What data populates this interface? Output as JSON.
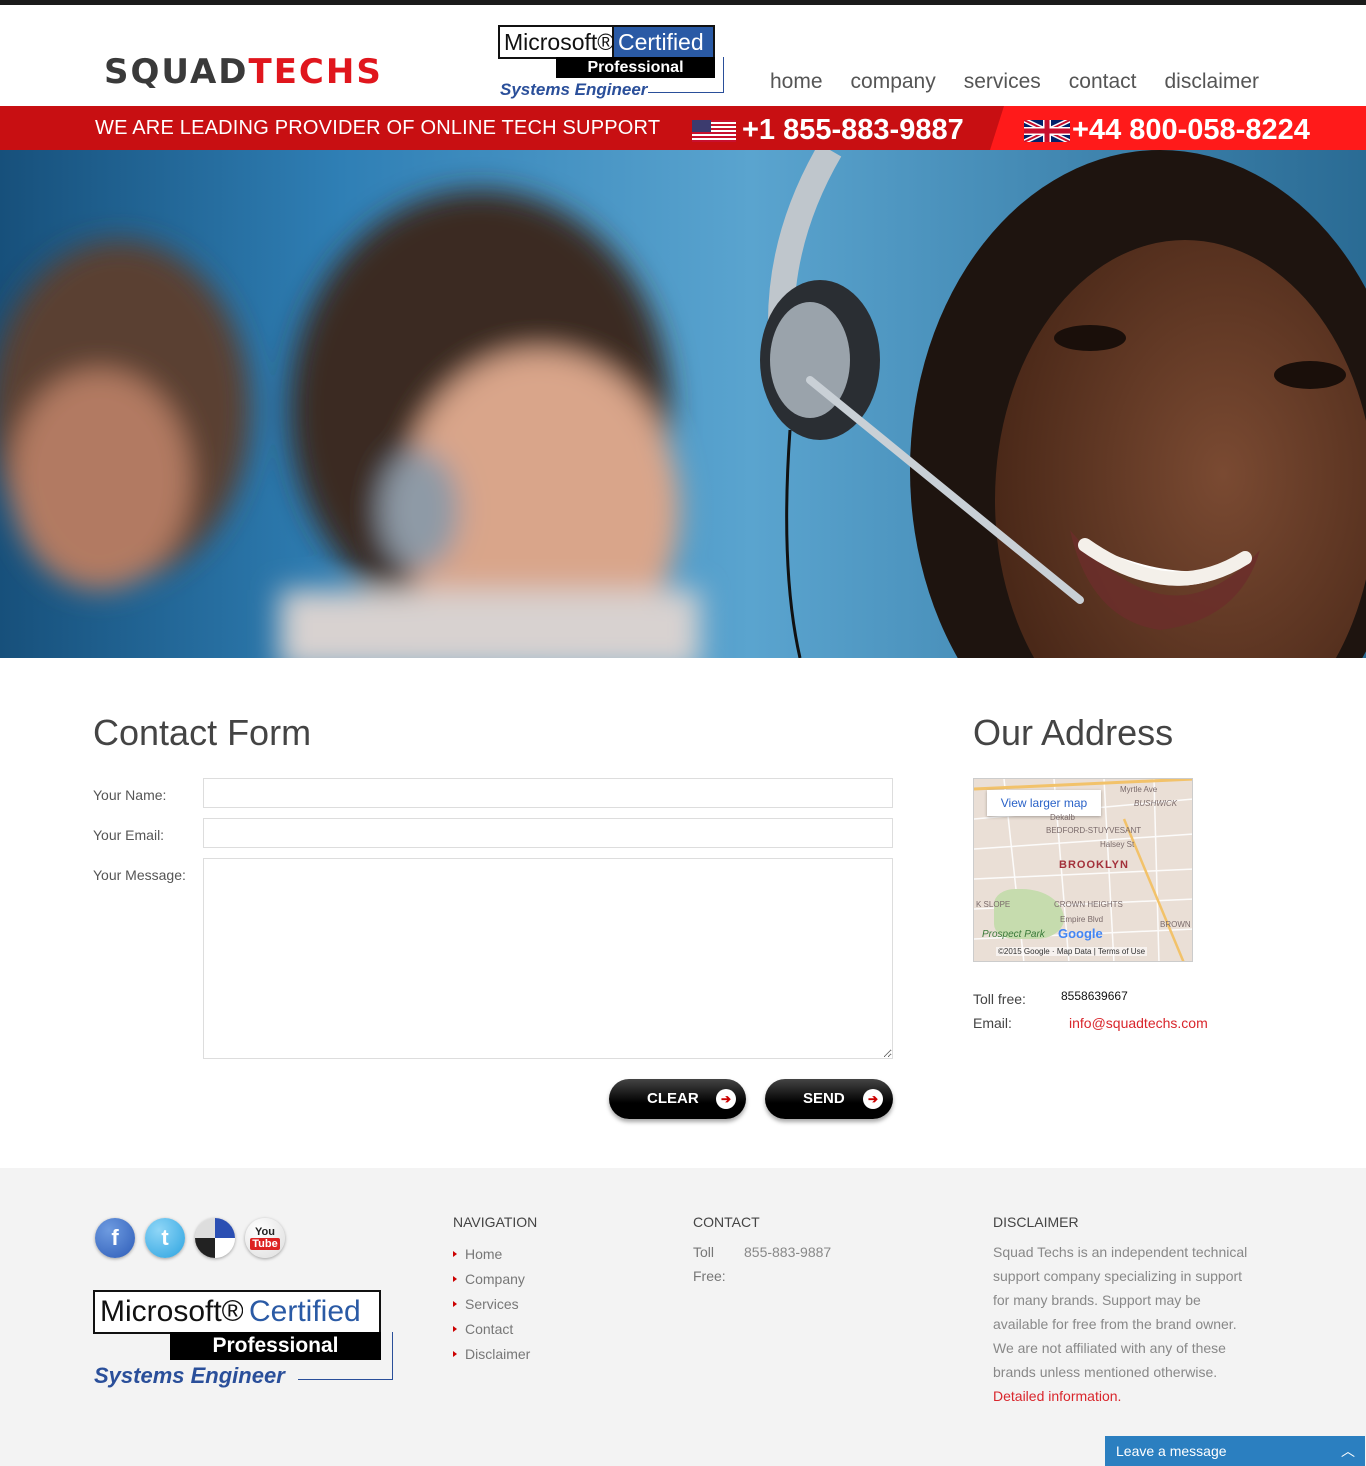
{
  "header": {
    "logo_part1": "SQUAD",
    "logo_part2": "TECHS",
    "badge": {
      "ms": "Microsoft®",
      "certified": "Certified",
      "professional": "Professional",
      "role": "Systems Engineer"
    },
    "nav": [
      "home",
      "company",
      "services",
      "contact",
      "disclaimer"
    ]
  },
  "strip": {
    "tagline": "WE ARE LEADING PROVIDER OF ONLINE TECH SUPPORT",
    "phone_us": "+1 855-883-9887",
    "phone_uk": "+44 800-058-8224",
    "flag_us": "us-flag-icon",
    "flag_uk": "uk-flag-icon"
  },
  "contact_form": {
    "title": "Contact Form",
    "name_label": "Your Name:",
    "email_label": "Your Email:",
    "message_label": "Your Message:",
    "name_value": "",
    "email_value": "",
    "message_value": "",
    "clear_label": "CLEAR",
    "send_label": "SEND"
  },
  "address": {
    "title": "Our Address",
    "map": {
      "view_larger": "View larger map",
      "area": "BROOKLYN",
      "labels": [
        "Myrtle Ave",
        "BUSHWICK",
        "BEDFORD-STUYVESANT",
        "Halsey St",
        "CROWN HEIGHTS",
        "Empire Blvd",
        "K SLOPE",
        "BROWN",
        "Dekalb"
      ],
      "park": "Prospect Park",
      "google": "Google",
      "copyright": "©2015 Google · Map Data",
      "terms": "Terms of Use"
    },
    "toll_free_label": "Toll free:",
    "toll_free_value": "8558639667",
    "email_label": "Email:",
    "email_value": "info@squadtechs.com"
  },
  "footer": {
    "social": [
      "facebook-icon",
      "twitter-icon",
      "delicious-icon",
      "youtube-icon"
    ],
    "youtube_text": [
      "You",
      "Tube"
    ],
    "navigation_title": "NAVIGATION",
    "navigation": [
      "Home",
      "Company",
      "Services",
      "Contact",
      "Disclaimer"
    ],
    "contact_title": "CONTACT",
    "contact_label_1": "Toll",
    "contact_label_2": "Free:",
    "contact_value": "855-883-9887",
    "disclaimer_title": "DISCLAIMER",
    "disclaimer_lines": [
      "Squad Techs is an independent technical",
      "support company specializing in support",
      "for many brands. Support may be",
      "available for free from the brand owner.",
      "We are not affiliated with any of these",
      "brands unless mentioned otherwise."
    ],
    "disclaimer_link": "Detailed information."
  },
  "chat": {
    "label": "Leave a message",
    "icon": "chevron-up-icon"
  },
  "colors": {
    "brand_red": "#e0161d",
    "strip_red": "#c80f12",
    "link_red": "#d9262c",
    "chat_blue": "#2b7fc0"
  }
}
